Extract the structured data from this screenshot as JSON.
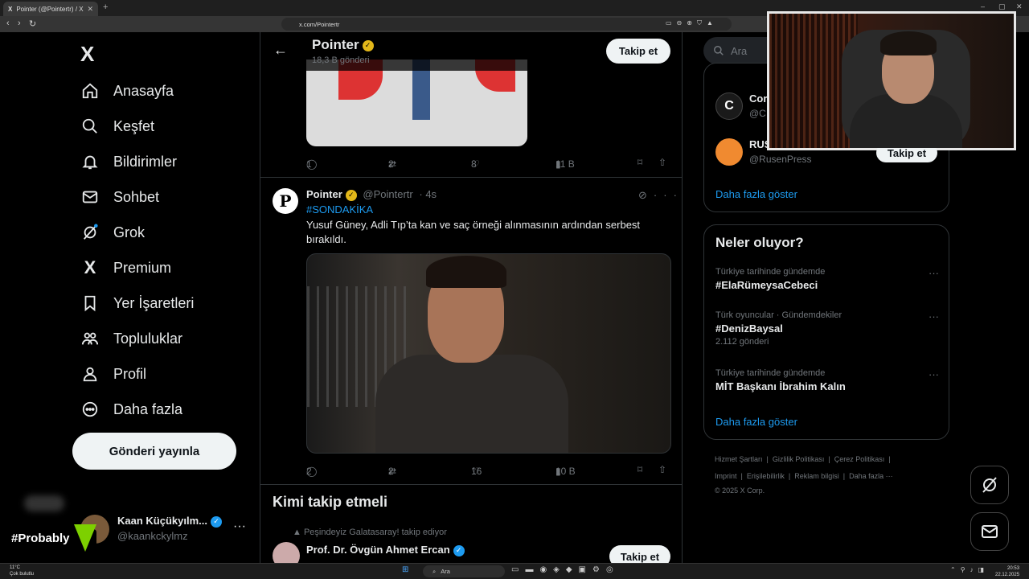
{
  "browser": {
    "tab_title": "Pointer (@Pointertr) / X",
    "tab_favicon": "X",
    "url": "x.com/Pointertr"
  },
  "nav": {
    "logo": "X",
    "items": [
      {
        "label": "Anasayfa",
        "icon": "home-icon"
      },
      {
        "label": "Keşfet",
        "icon": "search-icon"
      },
      {
        "label": "Bildirimler",
        "icon": "bell-icon"
      },
      {
        "label": "Sohbet",
        "icon": "mail-icon"
      },
      {
        "label": "Grok",
        "icon": "grok-icon"
      },
      {
        "label": "Premium",
        "icon": "x-icon"
      },
      {
        "label": "Yer İşaretleri",
        "icon": "bookmark-icon"
      },
      {
        "label": "Topluluklar",
        "icon": "people-icon"
      },
      {
        "label": "Profil",
        "icon": "person-icon"
      },
      {
        "label": "Daha fazla",
        "icon": "more-circle-icon"
      }
    ],
    "post_button": "Gönderi yayınla"
  },
  "account": {
    "name": "Kaan Küçükyılm...",
    "handle": "@kaankckylmz"
  },
  "overlay_badge": "#Probably",
  "profile_header": {
    "name": "Pointer",
    "posts_count": "18,3 B gönderi",
    "follow_label": "Takip et"
  },
  "tweet1": {
    "replies": "1",
    "reposts": "2",
    "likes": "8",
    "views": "11 B"
  },
  "tweet2": {
    "author": "Pointer",
    "handle": "@Pointertr",
    "time": "· 4s",
    "hashtag": "#SONDAKİKA",
    "text": "Yusuf Güney, Adli Tıp’ta kan ve saç örneği alınmasının ardından serbest bırakıldı.",
    "replies": "2",
    "reposts": "2",
    "likes": "16",
    "views": "10 B"
  },
  "who_to_follow_main": {
    "title": "Kimi takip etmeli",
    "context": "Peşindeyiz Galatasaray! takip ediyor",
    "name": "Prof. Dr. Övgün Ahmet Ercan",
    "follow_label": "Takip et"
  },
  "sidebar": {
    "search_placeholder": "Ara",
    "who_to_follow": [
      {
        "name": "Cor",
        "handle": "@C",
        "avatar_color": "#1a1a1a"
      },
      {
        "name": "RUS",
        "handle": "@RusenPress",
        "avatar_color": "#f08a30"
      }
    ],
    "follow_label": "Takip et",
    "show_more": "Daha fazla göster",
    "trends_title": "Neler oluyor?",
    "trends": [
      {
        "context": "Türkiye tarihinde gündemde",
        "title": "#ElaRümeysaCebeci",
        "count": ""
      },
      {
        "context": "Türk oyuncular · Gündemdekiler",
        "title": "#DenizBaysal",
        "count": "2.112 gönderi"
      },
      {
        "context": "Türkiye tarihinde gündemde",
        "title": "MİT Başkanı İbrahim Kalın",
        "count": ""
      }
    ],
    "trends_show_more": "Daha fazla göster",
    "footer_links": [
      "Hizmet Şartları",
      "Gizlilik Politikası",
      "Çerez Politikası",
      "Imprint",
      "Erişilebilirlik",
      "Reklam bilgisi",
      "Daha fazla ···"
    ],
    "copyright": "© 2025 X Corp."
  },
  "taskbar": {
    "weather_temp": "11°C",
    "weather_desc": "Çok bulutlu",
    "search_placeholder": "Ara",
    "time": "20:53",
    "date": "22.12.2025"
  },
  "colors": {
    "accent": "#1d9bf0",
    "background": "#000000",
    "verified_gold": "#e2b719"
  }
}
